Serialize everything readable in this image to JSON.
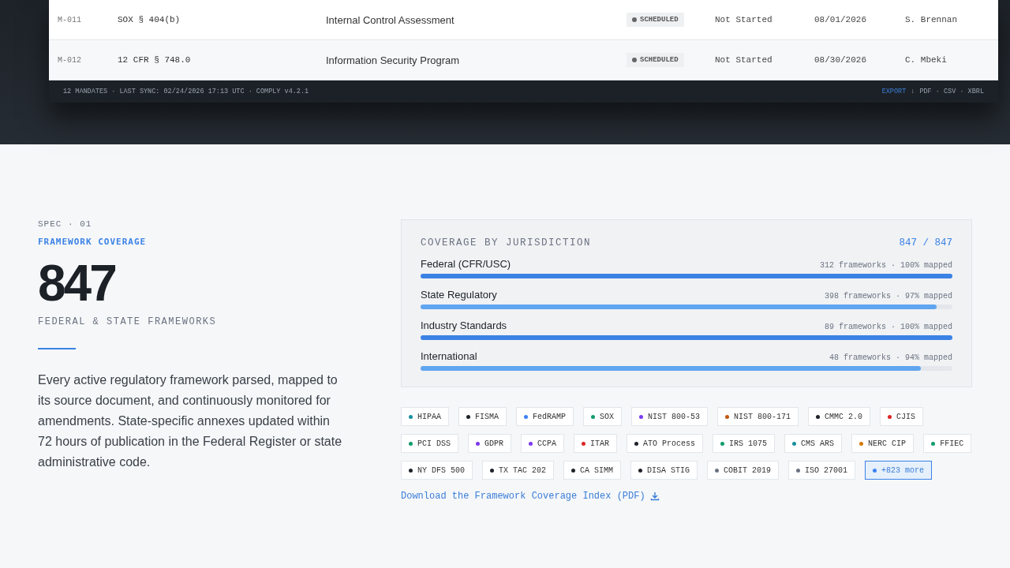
{
  "mandate_table": {
    "rows": [
      {
        "id": "M-011",
        "citation": "SOX § 404(b)",
        "title": "Internal Control Assessment",
        "status": "SCHEDULED",
        "progress": "Not Started",
        "due": "08/01/2026",
        "owner": "S. Brennan"
      },
      {
        "id": "M-012",
        "citation": "12 CFR § 748.0",
        "title": "Information Security Program",
        "status": "SCHEDULED",
        "progress": "Not Started",
        "due": "08/30/2026",
        "owner": "C. Mbeki"
      }
    ],
    "footer": "12 MANDATES · LAST SYNC: 02/24/2026 17:13 UTC · COMPLY v4.2.1",
    "export": {
      "label": "EXPORT",
      "arrow": "↓",
      "formats": "PDF · CSV · XBRL"
    }
  },
  "spec": {
    "eyebrow": "SPEC · 01",
    "title": "FRAMEWORK COVERAGE",
    "stat": "847",
    "stat_label": "FEDERAL & STATE FRAMEWORKS",
    "description": "Every active regulatory framework parsed, mapped to its source document, and continuously monitored for amendments. State-specific annexes updated within 72 hours of publication in the Federal Register or state administrative code."
  },
  "coverage": {
    "title": "COVERAGE BY JURISDICTION",
    "total": "847 / 847",
    "rows": [
      {
        "name": "Federal (CFR/USC)",
        "detail": "312 frameworks · 100% mapped",
        "level": 1
      },
      {
        "name": "State Regulatory",
        "detail": "398 frameworks · 97% mapped",
        "level": 0.97
      },
      {
        "name": "Industry Standards",
        "detail": "89 frameworks · 100% mapped",
        "level": 1
      },
      {
        "name": "International",
        "detail": "48 frameworks · 94% mapped",
        "level": 0.94
      }
    ]
  },
  "tags": [
    {
      "label": "HIPAA",
      "color": "#1a8fa0",
      "kind": "tag"
    },
    {
      "label": "FISMA",
      "color": "#1f2328",
      "kind": "tag"
    },
    {
      "label": "FedRAMP",
      "color": "#3b82f6",
      "kind": "tag"
    },
    {
      "label": "SOX",
      "color": "#0f9b6e",
      "kind": "tag"
    },
    {
      "label": "NIST 800-53",
      "color": "#7c3aed",
      "kind": "tag"
    },
    {
      "label": "NIST 800-171",
      "color": "#c2570c",
      "kind": "tag"
    },
    {
      "label": "CMMC 2.0",
      "color": "#1f2328",
      "kind": "tag"
    },
    {
      "label": "CJIS",
      "color": "#dc2626",
      "kind": "tag"
    },
    {
      "label": "PCI DSS",
      "color": "#0f9b6e",
      "kind": "tag"
    },
    {
      "label": "GDPR",
      "color": "#7c3aed",
      "kind": "tag"
    },
    {
      "label": "CCPA",
      "color": "#7c3aed",
      "kind": "tag"
    },
    {
      "label": "ITAR",
      "color": "#dc2626",
      "kind": "tag"
    },
    {
      "label": "ATO Process",
      "color": "#1f2328",
      "kind": "tag"
    },
    {
      "label": "IRS 1075",
      "color": "#0f9b6e",
      "kind": "tag"
    },
    {
      "label": "CMS ARS",
      "color": "#1a8fa0",
      "kind": "tag"
    },
    {
      "label": "NERC CIP",
      "color": "#d97706",
      "kind": "tag"
    },
    {
      "label": "FFIEC",
      "color": "#0f9b6e",
      "kind": "tag"
    },
    {
      "label": "NY DFS 500",
      "color": "#1f2328",
      "kind": "tag"
    },
    {
      "label": "TX TAC 202",
      "color": "#1f2328",
      "kind": "tag"
    },
    {
      "label": "CA SIMM",
      "color": "#1f2328",
      "kind": "tag"
    },
    {
      "label": "DISA STIG",
      "color": "#1f2328",
      "kind": "tag"
    },
    {
      "label": "COBIT 2019",
      "color": "#6b7280",
      "kind": "tag"
    },
    {
      "label": "ISO 27001",
      "color": "#6b7280",
      "kind": "tag"
    },
    {
      "label": "+823 more",
      "color": "#3b82f6",
      "kind": "more"
    }
  ],
  "download_link": "Download the Framework Coverage Index (PDF)"
}
